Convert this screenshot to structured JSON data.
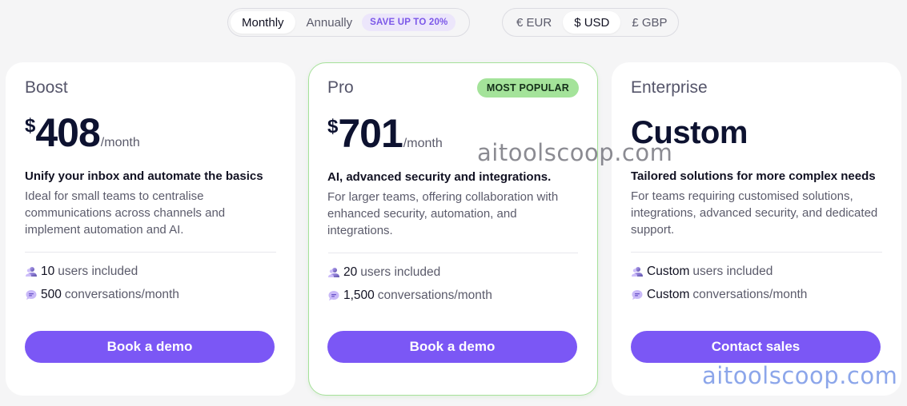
{
  "billing": {
    "monthly": "Monthly",
    "annually": "Annually",
    "save_badge": "SAVE UP TO 20%"
  },
  "currency": {
    "options": [
      "€ EUR",
      "$ USD",
      "£ GBP"
    ],
    "selected": "$ USD"
  },
  "plans": [
    {
      "name": "Boost",
      "currency_symbol": "$",
      "price": "408",
      "period": "/month",
      "tagline": "Unify your inbox and automate the basics",
      "description": "Ideal for small teams to centralise communications across channels and implement automation and AI.",
      "users_value": "10",
      "users_label": "users included",
      "conv_value": "500",
      "conv_label": "conversations/month",
      "cta": "Book a demo"
    },
    {
      "name": "Pro",
      "badge": "MOST POPULAR",
      "currency_symbol": "$",
      "price": "701",
      "period": "/month",
      "tagline": "AI, advanced security and integrations.",
      "description": "For larger teams, offering collaboration with enhanced security, automation, and integrations.",
      "users_value": "20",
      "users_label": "users included",
      "conv_value": "1,500",
      "conv_label": "conversations/month",
      "cta": "Book a demo"
    },
    {
      "name": "Enterprise",
      "price": "Custom",
      "tagline": "Tailored solutions for more complex needs",
      "description": "For teams requiring customised solutions, integrations, advanced security, and dedicated support.",
      "users_value": "Custom",
      "users_label": "users included",
      "conv_value": "Custom",
      "conv_label": "conversations/month",
      "cta": "Contact sales"
    }
  ],
  "watermark": "aitoolscoop.com",
  "colors": {
    "accent": "#7b57f5",
    "popular_badge": "#a4e39a",
    "pro_border": "#a6e19a",
    "background": "#f5f5f6"
  },
  "icons": {
    "users": "users-icon",
    "conversations": "chat-bubble-icon"
  }
}
